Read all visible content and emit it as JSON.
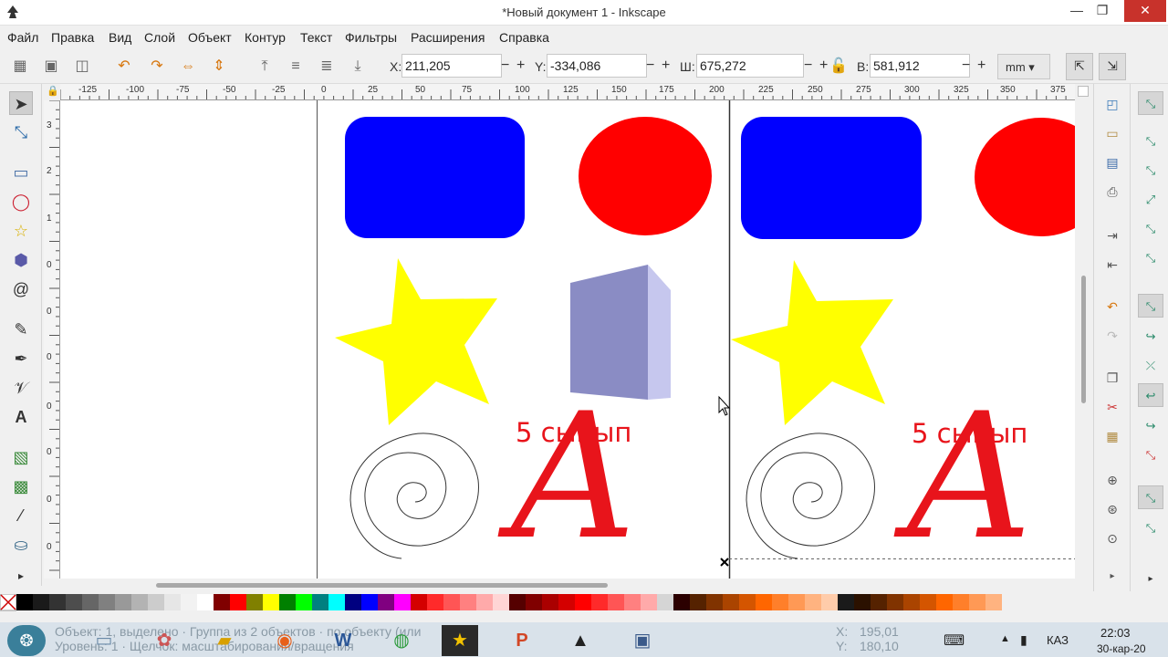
{
  "window": {
    "title": "*Новый документ 1 - Inkscape",
    "minimize": "—",
    "maximize": "❐",
    "close": "✕"
  },
  "menu": [
    "Файл",
    "Правка",
    "Вид",
    "Слой",
    "Объект",
    "Контур",
    "Текст",
    "Фильтры",
    "Расширения",
    "Справка"
  ],
  "toolbar": {
    "x_label": "X:",
    "x_value": "211,205",
    "y_label": "Y:",
    "y_value": "-334,086",
    "w_label": "Ш:",
    "w_value": "675,272",
    "h_label": "В:",
    "h_value": "581,912",
    "unit": "mm",
    "minus": "−",
    "plus": "+"
  },
  "ruler": {
    "h_labels": [
      "-125",
      "-100",
      "-75",
      "-50",
      "-25",
      "0",
      "25",
      "50",
      "75",
      "100",
      "125",
      "150",
      "175",
      "200",
      "225",
      "250",
      "275",
      "300",
      "325",
      "350",
      "375"
    ],
    "v_labels": [
      "3",
      "2",
      "1",
      "0",
      "0",
      "0",
      "0",
      "0",
      "0",
      "0",
      "0",
      "0"
    ]
  },
  "canvas": {
    "text_left": "5 сынып",
    "text_right": "5 сынып",
    "letter_left": "A",
    "letter_right": "A",
    "colors": {
      "blue": "#0000ff",
      "red": "#ff0000",
      "yellow": "#ffff00",
      "box_front": "#8a8cc4",
      "box_side": "#c6c7ee",
      "box_top": "#a8aad8"
    }
  },
  "palette": [
    "#000000",
    "#1a1a1a",
    "#333333",
    "#4d4d4d",
    "#666666",
    "#808080",
    "#999999",
    "#b3b3b3",
    "#cccccc",
    "#e6e6e6",
    "#f2f2f2",
    "#ffffff",
    "#800000",
    "#ff0000",
    "#808000",
    "#ffff00",
    "#008000",
    "#00ff00",
    "#008080",
    "#00ffff",
    "#000080",
    "#0000ff",
    "#800080",
    "#ff00ff",
    "#d40000",
    "#ff2a2a",
    "#ff5555",
    "#ff8080",
    "#ffaaaa",
    "#ffd5d5",
    "#550000",
    "#800000",
    "#aa0000",
    "#d40000",
    "#ff0000",
    "#ff2a2a",
    "#ff5555",
    "#ff8080",
    "#ffaaaa",
    "#d5d5d5",
    "#2b0000",
    "#552200",
    "#803300",
    "#aa4400",
    "#d45500",
    "#ff6600",
    "#ff7f2a",
    "#ff9955",
    "#ffb380",
    "#ffccaa",
    "#1a1a1a",
    "#2b1100",
    "#552200",
    "#803300",
    "#aa4400",
    "#d45500",
    "#ff6600",
    "#ff7f2a",
    "#ff9955",
    "#ffb380"
  ],
  "taskbar": {
    "ghost_left": "Объект: 1, выделено   ·   Группа из 2 объектов   ·   по объекту (или",
    "ghost_left2": "Уровень: 1   ·   Щелчок: масштабирования/вращения",
    "ghost_coords_x_label": "X:",
    "ghost_coords_x": "195,01",
    "ghost_coords_y_label": "Y:",
    "ghost_coords_y": "180,10",
    "lang": "КАЗ",
    "time": "22:03",
    "date": "30-кар-20"
  }
}
